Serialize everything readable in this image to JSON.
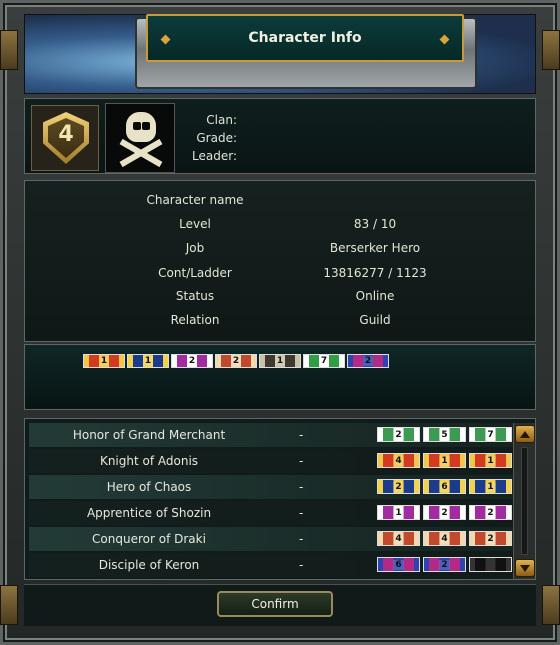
{
  "window": {
    "title": "Character Info"
  },
  "clan": {
    "rank": "4",
    "labels": {
      "clan": "Clan:",
      "grade": "Grade:",
      "leader": "Leader:"
    },
    "emblem_icon": "skull-crossbones-icon"
  },
  "info": {
    "rows": [
      {
        "label": "Character name",
        "value": ""
      },
      {
        "label": "Level",
        "value": "83  /  10"
      },
      {
        "label": "Job",
        "value": "Berserker Hero"
      },
      {
        "label": "Cont/Ladder",
        "value": "13816277  /  1123"
      },
      {
        "label": "Status",
        "value": "Online"
      },
      {
        "label": "Relation",
        "value": "Guild"
      }
    ]
  },
  "ribbons": [
    {
      "text": "1",
      "color": "#d23b1f",
      "stripe": "#f2c64a"
    },
    {
      "text": "1",
      "color": "#1b3b8c",
      "stripe": "#f2d24a"
    },
    {
      "text": "2",
      "color": "#a12ca1",
      "stripe": "#ffffff"
    },
    {
      "text": "2",
      "color": "#c0492e",
      "stripe": "#f0d9b0"
    },
    {
      "text": "1",
      "color": "#3e3a30",
      "stripe": "#c9c2a8"
    },
    {
      "text": "7",
      "color": "#2f9e45",
      "stripe": "#ffffff"
    },
    {
      "text": "2",
      "color": "#b02a86",
      "stripe": "#2d43b0"
    }
  ],
  "titles": {
    "rows": [
      {
        "name": "Honor of Grand Merchant",
        "value": "-",
        "ribbons": [
          {
            "text": "2",
            "color": "#3c9a52",
            "stripe": "#ffffff"
          },
          {
            "text": "5",
            "color": "#3c9a52",
            "stripe": "#ffffff"
          },
          {
            "text": "7",
            "color": "#3c9a52",
            "stripe": "#ffffff"
          }
        ]
      },
      {
        "name": "Knight of Adonis",
        "value": "-",
        "ribbons": [
          {
            "text": "4",
            "color": "#d23b1f",
            "stripe": "#f2c64a"
          },
          {
            "text": "1",
            "color": "#d23b1f",
            "stripe": "#f2c64a"
          },
          {
            "text": "1",
            "color": "#d23b1f",
            "stripe": "#f2c64a"
          }
        ]
      },
      {
        "name": "Hero of Chaos",
        "value": "-",
        "ribbons": [
          {
            "text": "2",
            "color": "#1b3b8c",
            "stripe": "#f2d24a"
          },
          {
            "text": "6",
            "color": "#1b3b8c",
            "stripe": "#f2d24a"
          },
          {
            "text": "1",
            "color": "#1b3b8c",
            "stripe": "#f2d24a"
          }
        ]
      },
      {
        "name": "Apprentice of Shozin",
        "value": "-",
        "ribbons": [
          {
            "text": "1",
            "color": "#a12ca1",
            "stripe": "#ffffff"
          },
          {
            "text": "2",
            "color": "#a12ca1",
            "stripe": "#ffffff"
          },
          {
            "text": "2",
            "color": "#a12ca1",
            "stripe": "#ffffff"
          }
        ]
      },
      {
        "name": "Conqueror of Draki",
        "value": "-",
        "ribbons": [
          {
            "text": "4",
            "color": "#c0492e",
            "stripe": "#f0d9b0"
          },
          {
            "text": "4",
            "color": "#c0492e",
            "stripe": "#f0d9b0"
          },
          {
            "text": "2",
            "color": "#c0492e",
            "stripe": "#f0d9b0"
          }
        ]
      },
      {
        "name": "Disciple of Keron",
        "value": "-",
        "ribbons": [
          {
            "text": "6",
            "color": "#b02a86",
            "stripe": "#2d43b0"
          },
          {
            "text": "2",
            "color": "#b02a86",
            "stripe": "#2d43b0"
          },
          {
            "text": "",
            "color": "#111111",
            "stripe": "#333333"
          }
        ]
      }
    ]
  },
  "footer": {
    "confirm_label": "Confirm"
  }
}
